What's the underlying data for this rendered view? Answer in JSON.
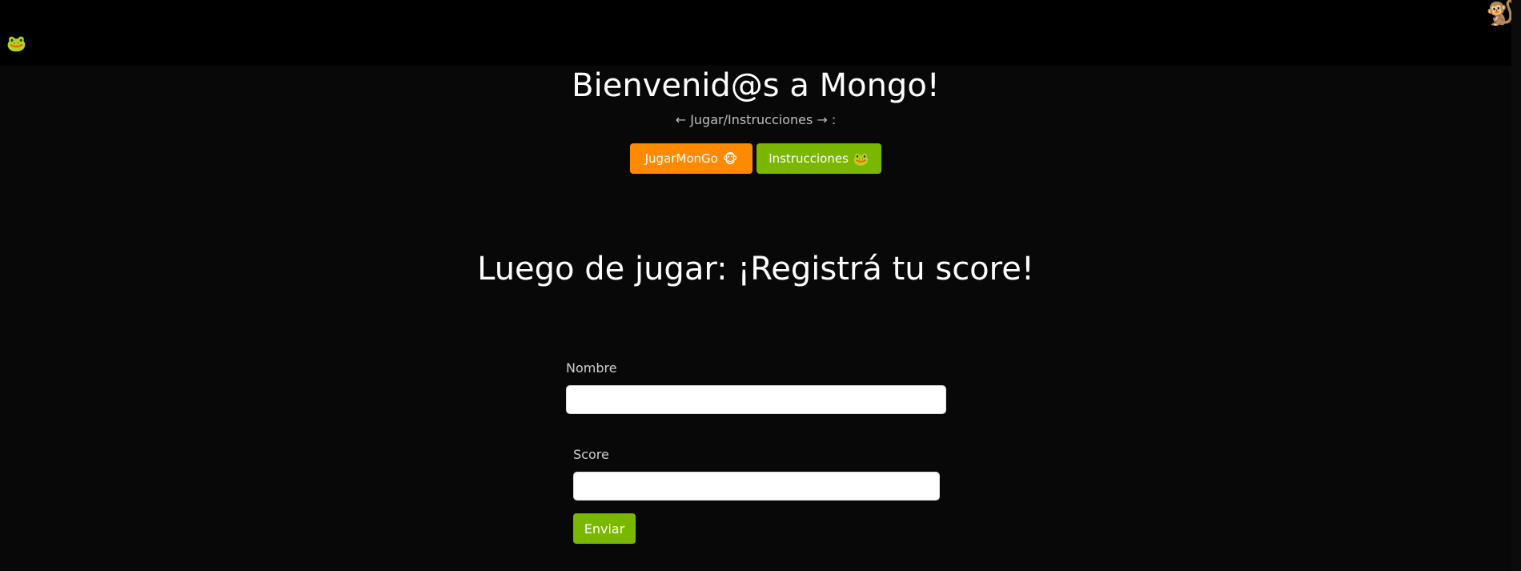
{
  "header": {
    "left_icon": "🐸",
    "right_icon": "🐒"
  },
  "hero": {
    "title": "Bienvenid@s a Mongo!",
    "subtitle": "← Jugar/Instrucciones → :",
    "play_button": {
      "label": "JugarMonGo",
      "emoji": "🐵"
    },
    "instructions_button": {
      "label": "Instrucciones",
      "emoji": "🐸"
    }
  },
  "score_section": {
    "heading": "Luego de jugar: ¡Registrá tu score!",
    "name_label": "Nombre",
    "name_value": "",
    "score_label": "Score",
    "score_value": "",
    "submit_label": "Enviar"
  },
  "colors": {
    "background": "#080808",
    "topbar": "#000000",
    "orange": "#ff8a00",
    "green": "#7ab800"
  }
}
